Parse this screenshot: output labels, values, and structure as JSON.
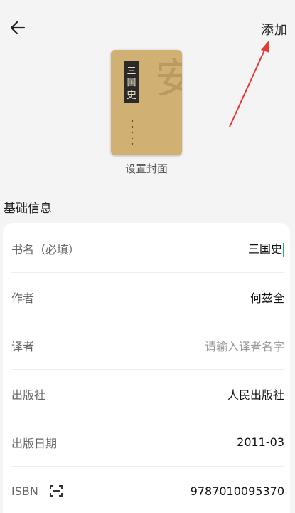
{
  "header": {
    "add_label": "添加",
    "back_icon": "back-arrow-icon"
  },
  "cover": {
    "caption": "设置封面",
    "book_title_art": "三国史"
  },
  "section": {
    "title": "基础信息"
  },
  "form": {
    "rows": [
      {
        "label": "书名（必填）",
        "value": "三国史",
        "placeholder": "",
        "focused": true
      },
      {
        "label": "作者",
        "value": "何兹全",
        "placeholder": ""
      },
      {
        "label": "译者",
        "value": "",
        "placeholder": "请输入译者名字"
      },
      {
        "label": "出版社",
        "value": "人民出版社",
        "placeholder": ""
      },
      {
        "label": "出版日期",
        "value": "2011-03",
        "placeholder": ""
      },
      {
        "label": "ISBN",
        "value": "9787010095370",
        "placeholder": "",
        "icon": "scan-icon"
      }
    ]
  },
  "colors": {
    "background": "#f4f4f4",
    "card": "#ffffff",
    "caret": "#1fb866",
    "annotation": "#e53935",
    "cover_bg": "#c9a86a"
  }
}
